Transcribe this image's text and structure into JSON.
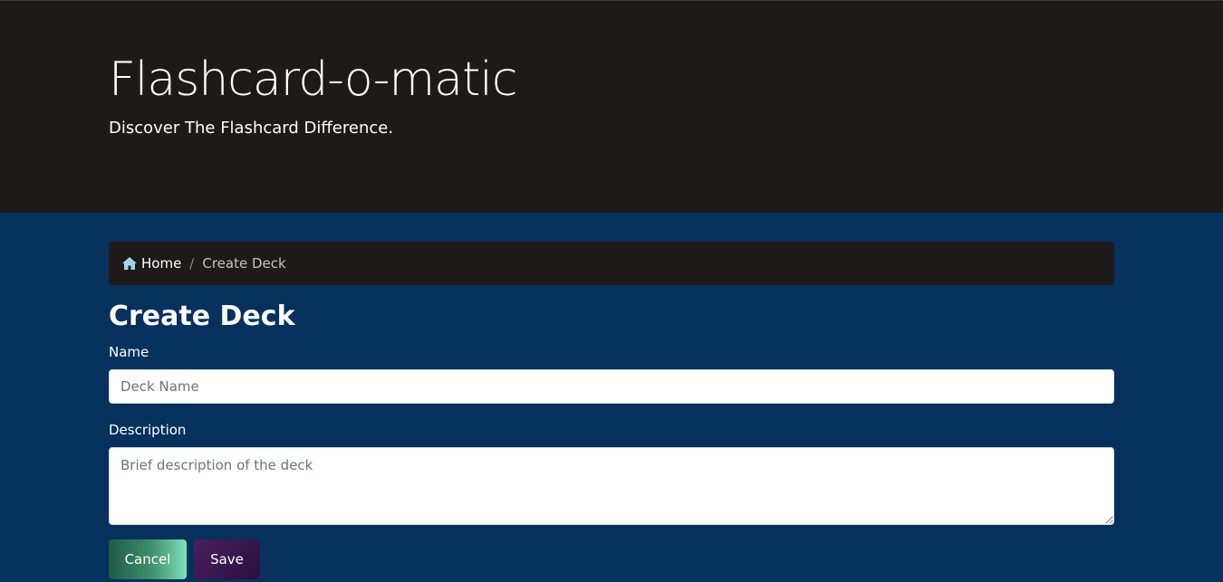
{
  "header": {
    "title": "Flashcard-o-matic",
    "subtitle": "Discover The Flashcard Difference."
  },
  "breadcrumb": {
    "home_icon": "home-icon",
    "home_label": "Home",
    "separator": "/",
    "current_label": "Create Deck"
  },
  "page": {
    "title": "Create Deck"
  },
  "form": {
    "name_label": "Name",
    "name_value": "",
    "name_placeholder": "Deck Name",
    "description_label": "Description",
    "description_value": "",
    "description_placeholder": "Brief description of the deck",
    "cancel_label": "Cancel",
    "save_label": "Save"
  },
  "colors": {
    "header_bg": "#1f1a1a",
    "page_bg": "#06315d",
    "home_icon": "#9ad8e6",
    "cancel_gradient_end": "#7fe0b5",
    "save_bg": "#3a1650"
  }
}
